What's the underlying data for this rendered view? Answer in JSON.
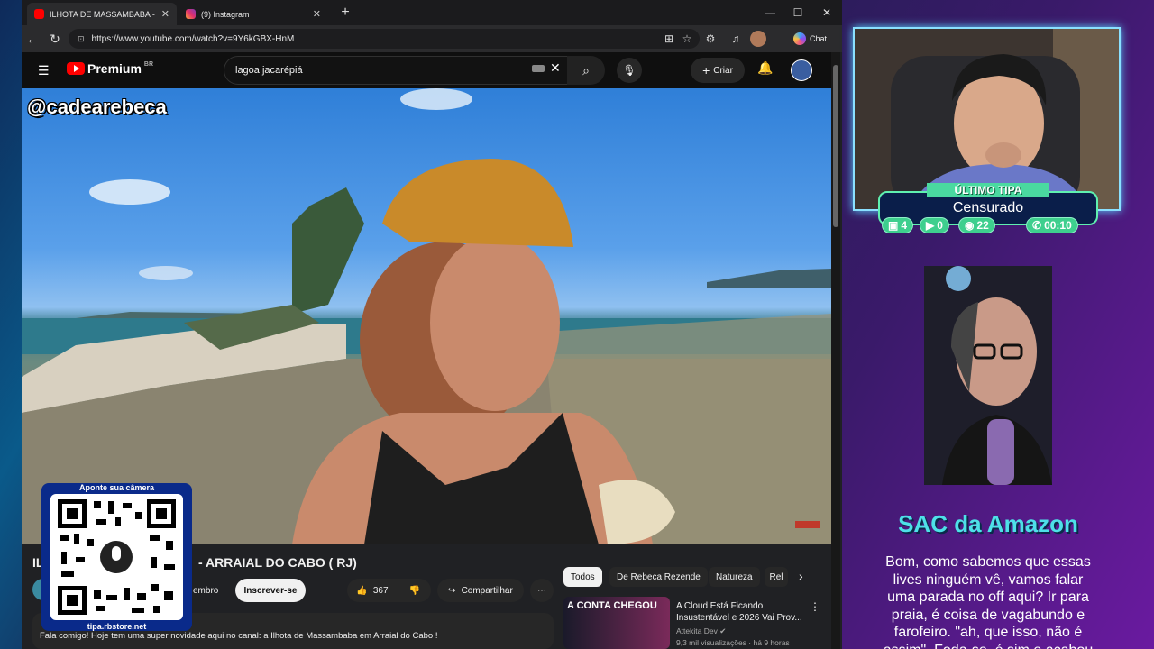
{
  "browser": {
    "tabs": [
      {
        "title": "ILHOTA DE MASSAMBABA - ARRAIAL DO CABO ( RJ)",
        "active": true,
        "icon": "youtube-icon"
      },
      {
        "title": "(9) Instagram",
        "active": false,
        "icon": "instagram-icon"
      }
    ],
    "url": "https://www.youtube.com/watch?v=9Y6kGBX-HnM",
    "chat_label": "Chat"
  },
  "youtube": {
    "logo_text": "Premium",
    "logo_region": "BR",
    "search_value": "lagoa jacarépiá",
    "create_label": "Criar",
    "video_watermark": "@cadearebeca",
    "video_title": "ILHOTA DE MASSAMBABA - ARRAIAL DO CABO ( RJ)",
    "video_title_visible": "- ARRAIAL DO CABO ( RJ)",
    "member_label": "embro",
    "subscribe_label": "Inscrever-se",
    "like_count": "367",
    "share_label": "Compartilhar",
    "chips": [
      "Todos",
      "De Rebeca Rezende",
      "Natureza",
      "Rel"
    ],
    "recommended": {
      "thumb_text": "A CONTA CHEGOU",
      "title_line1": "A Cloud Está Ficando",
      "title_line2": "Insustentável e 2026 Vai Prov...",
      "channel": "Attekita Dev",
      "meta": "9,3 mil visualizações · há 9 horas"
    },
    "description": "Fala comigo! Hoje tem uma super novidade aqui no canal: a Ilhota de Massambaba em Arraial do Cabo !"
  },
  "qr": {
    "top_text": "Aponte sua câmera",
    "bottom_text": "tipa.rbstore.net"
  },
  "stream": {
    "last_tipa_label": "ÚLTIMO TIPA",
    "last_tipa_name": "Censurado",
    "stats": [
      {
        "icon": "chat-icon",
        "value": "4"
      },
      {
        "icon": "video-icon",
        "value": "0"
      },
      {
        "icon": "coin-icon",
        "value": "22"
      },
      {
        "icon": "whatsapp-icon",
        "value": "00:10"
      }
    ],
    "sac_title": "SAC da Amazon",
    "sac_lines": [
      "Bom, como sabemos que essas",
      "lives ninguém vê, vamos falar",
      "uma parada no off aqui? Ir para",
      "praia, é coisa de vagabundo e",
      "farofeiro. \"ah, que isso, não é",
      "assim\". Foda-se, é sim e acabou"
    ]
  }
}
